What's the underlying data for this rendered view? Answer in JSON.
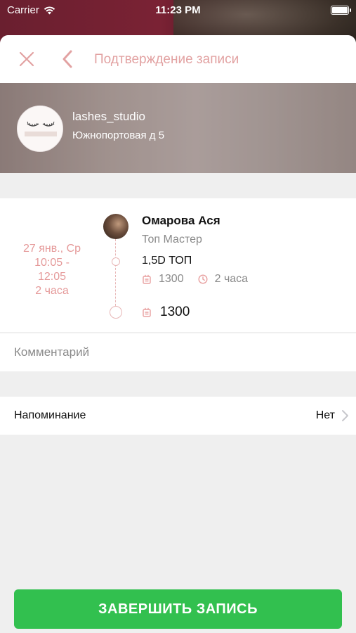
{
  "status_bar": {
    "carrier": "Carrier",
    "time": "11:23 PM"
  },
  "header": {
    "title": "Подтверждение записи"
  },
  "salon": {
    "name": "lashes_studio",
    "address": "Южнопортовая д 5"
  },
  "appointment": {
    "date": "27 янв., Ср",
    "time_range_start": "10:05 -",
    "time_range_end": "12:05",
    "duration": "2 часа"
  },
  "master": {
    "name": "Омарова Ася",
    "role": "Топ Мастер"
  },
  "service": {
    "name": "1,5D ТОП",
    "price": "1300",
    "duration": "2 часа"
  },
  "total": {
    "price": "1300"
  },
  "comment": {
    "placeholder": "Комментарий"
  },
  "reminder": {
    "label": "Напоминание",
    "value": "Нет"
  },
  "finish_button": {
    "label": "ЗАВЕРШИТЬ ЗАПИСЬ"
  },
  "colors": {
    "accent": "#e2a2a2",
    "button": "#32c04f"
  }
}
